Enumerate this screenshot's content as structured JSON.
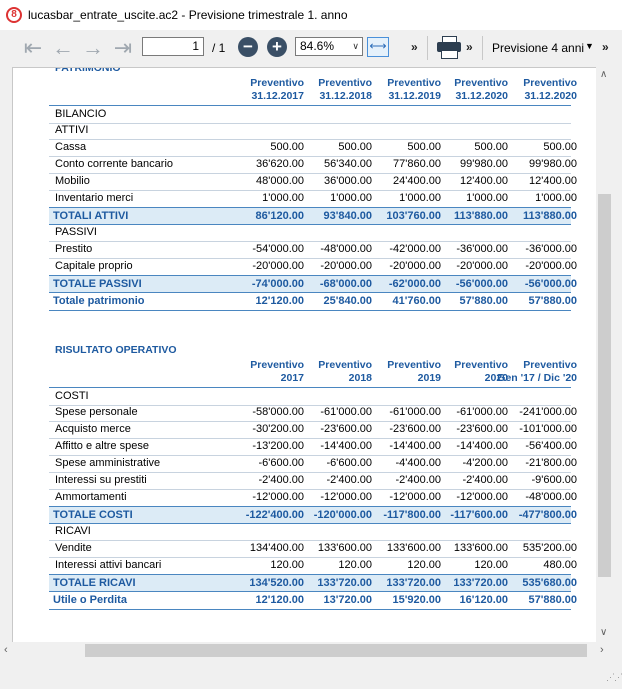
{
  "window": {
    "title": "lucasbar_entrate_uscite.ac2 - Previsione trimestrale 1. anno"
  },
  "toolbar": {
    "page_value": "1",
    "page_total": "/ 1",
    "zoom_value": "84.6%",
    "period_label": "Previsione 4 anni"
  },
  "patrimonio": {
    "title": "PATRIMONIO",
    "headers": [
      [
        "Preventivo",
        "31.12.2017"
      ],
      [
        "Preventivo",
        "31.12.2018"
      ],
      [
        "Preventivo",
        "31.12.2019"
      ],
      [
        "Preventivo",
        "31.12.2020"
      ],
      [
        "Preventivo",
        "31.12.2020"
      ]
    ],
    "rows": [
      {
        "label": "BILANCIO",
        "values": [
          "",
          "",
          "",
          "",
          ""
        ],
        "kind": "group"
      },
      {
        "label": "ATTIVI",
        "values": [
          "",
          "",
          "",
          "",
          ""
        ],
        "kind": "group"
      },
      {
        "label": "Cassa",
        "values": [
          "500.00",
          "500.00",
          "500.00",
          "500.00",
          "500.00"
        ],
        "kind": "item"
      },
      {
        "label": "Conto corrente bancario",
        "values": [
          "36'620.00",
          "56'340.00",
          "77'860.00",
          "99'980.00",
          "99'980.00"
        ],
        "kind": "item"
      },
      {
        "label": "Mobilio",
        "values": [
          "48'000.00",
          "36'000.00",
          "24'400.00",
          "12'400.00",
          "12'400.00"
        ],
        "kind": "item"
      },
      {
        "label": "Inventario merci",
        "values": [
          "1'000.00",
          "1'000.00",
          "1'000.00",
          "1'000.00",
          "1'000.00"
        ],
        "kind": "item"
      },
      {
        "label": "TOTALI ATTIVI",
        "values": [
          "86'120.00",
          "93'840.00",
          "103'760.00",
          "113'880.00",
          "113'880.00"
        ],
        "kind": "total"
      },
      {
        "label": "PASSIVI",
        "values": [
          "",
          "",
          "",
          "",
          ""
        ],
        "kind": "group"
      },
      {
        "label": "Prestito",
        "values": [
          "-54'000.00",
          "-48'000.00",
          "-42'000.00",
          "-36'000.00",
          "-36'000.00"
        ],
        "kind": "item"
      },
      {
        "label": "Capitale proprio",
        "values": [
          "-20'000.00",
          "-20'000.00",
          "-20'000.00",
          "-20'000.00",
          "-20'000.00"
        ],
        "kind": "item"
      },
      {
        "label": "TOTALE PASSIVI",
        "values": [
          "-74'000.00",
          "-68'000.00",
          "-62'000.00",
          "-56'000.00",
          "-56'000.00"
        ],
        "kind": "total"
      },
      {
        "label": "Totale patrimonio",
        "values": [
          "12'120.00",
          "25'840.00",
          "41'760.00",
          "57'880.00",
          "57'880.00"
        ],
        "kind": "result"
      }
    ]
  },
  "risultato": {
    "title": "RISULTATO OPERATIVO",
    "headers": [
      [
        "Preventivo",
        "2017"
      ],
      [
        "Preventivo",
        "2018"
      ],
      [
        "Preventivo",
        "2019"
      ],
      [
        "Preventivo",
        "2020"
      ],
      [
        "Preventivo",
        "Gen '17 / Dic '20"
      ]
    ],
    "rows": [
      {
        "label": "COSTI",
        "values": [
          "",
          "",
          "",
          "",
          ""
        ],
        "kind": "group"
      },
      {
        "label": "Spese personale",
        "values": [
          "-58'000.00",
          "-61'000.00",
          "-61'000.00",
          "-61'000.00",
          "-241'000.00"
        ],
        "kind": "item"
      },
      {
        "label": "Acquisto merce",
        "values": [
          "-30'200.00",
          "-23'600.00",
          "-23'600.00",
          "-23'600.00",
          "-101'000.00"
        ],
        "kind": "item"
      },
      {
        "label": "Affitto e altre spese",
        "values": [
          "-13'200.00",
          "-14'400.00",
          "-14'400.00",
          "-14'400.00",
          "-56'400.00"
        ],
        "kind": "item"
      },
      {
        "label": "Spese amministrative",
        "values": [
          "-6'600.00",
          "-6'600.00",
          "-4'400.00",
          "-4'200.00",
          "-21'800.00"
        ],
        "kind": "item"
      },
      {
        "label": "Interessi su prestiti",
        "values": [
          "-2'400.00",
          "-2'400.00",
          "-2'400.00",
          "-2'400.00",
          "-9'600.00"
        ],
        "kind": "item"
      },
      {
        "label": "Ammortamenti",
        "values": [
          "-12'000.00",
          "-12'000.00",
          "-12'000.00",
          "-12'000.00",
          "-48'000.00"
        ],
        "kind": "item"
      },
      {
        "label": "TOTALE COSTI",
        "values": [
          "-122'400.00",
          "-120'000.00",
          "-117'800.00",
          "-117'600.00",
          "-477'800.00"
        ],
        "kind": "total"
      },
      {
        "label": "RICAVI",
        "values": [
          "",
          "",
          "",
          "",
          ""
        ],
        "kind": "group"
      },
      {
        "label": "Vendite",
        "values": [
          "134'400.00",
          "133'600.00",
          "133'600.00",
          "133'600.00",
          "535'200.00"
        ],
        "kind": "item"
      },
      {
        "label": "Interessi attivi bancari",
        "values": [
          "120.00",
          "120.00",
          "120.00",
          "120.00",
          "480.00"
        ],
        "kind": "item"
      },
      {
        "label": "TOTALE RICAVI",
        "values": [
          "134'520.00",
          "133'720.00",
          "133'720.00",
          "133'720.00",
          "535'680.00"
        ],
        "kind": "total"
      },
      {
        "label": "Utile o Perdita",
        "values": [
          "12'120.00",
          "13'720.00",
          "15'920.00",
          "16'120.00",
          "57'880.00"
        ],
        "kind": "result"
      }
    ]
  }
}
